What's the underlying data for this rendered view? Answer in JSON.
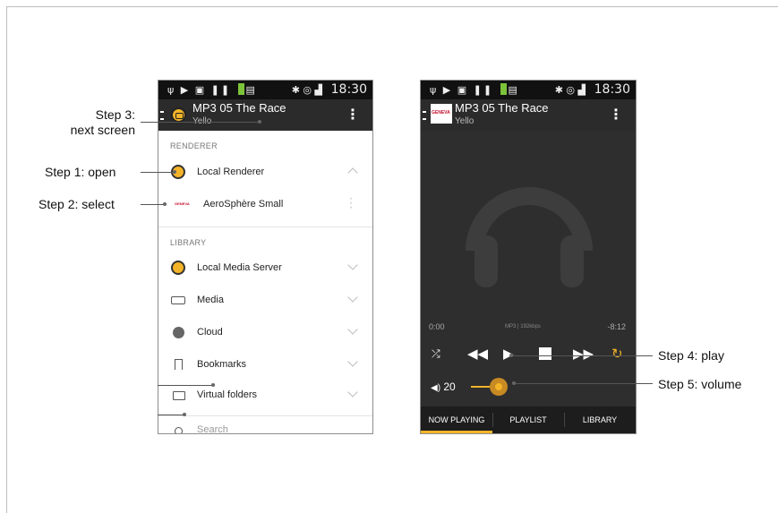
{
  "left_phone": {
    "status_time": "18:30",
    "title": "MP3 05 The Race",
    "subtitle": "Yello",
    "overflow_glyph": "⋮",
    "renderer_section": "RENDERER",
    "library_section": "LIBRARY",
    "renderers": [
      {
        "label": "Local Renderer",
        "icon": "speaker-icon"
      },
      {
        "label": "AeroSphère Small",
        "icon": "geneva-logo"
      }
    ],
    "library": [
      {
        "label": "Local Media Server",
        "icon": "speaker-icon"
      },
      {
        "label": "Media",
        "icon": "drive-icon"
      },
      {
        "label": "Cloud",
        "icon": "globe-icon"
      },
      {
        "label": "Bookmarks",
        "icon": "bookmark-icon"
      },
      {
        "label": "Virtual folders",
        "icon": "folder-icon"
      }
    ],
    "search_placeholder": "Search",
    "geneva_text": "GENEVA"
  },
  "right_phone": {
    "status_time": "18:30",
    "title": "MP3 05 The Race",
    "subtitle": "Yello",
    "overflow_glyph": "⋮",
    "geneva_text": "GENEVA",
    "elapsed": "0:00",
    "format": "MP3 | 192kbps",
    "remaining": "-8:12",
    "volume_label": "20",
    "volume_icon": "speaker-icon",
    "tabs": [
      "NOW PLAYING",
      "PLAYLIST",
      "LIBRARY"
    ],
    "accent_color": "#f3b429"
  },
  "callouts": {
    "step3_line1": "Step 3:",
    "step3_line2": "next screen",
    "step1": "Step 1: open",
    "step2": "Step 2: select",
    "step4": "Step 4: play",
    "step5": "Step 5: volume"
  }
}
